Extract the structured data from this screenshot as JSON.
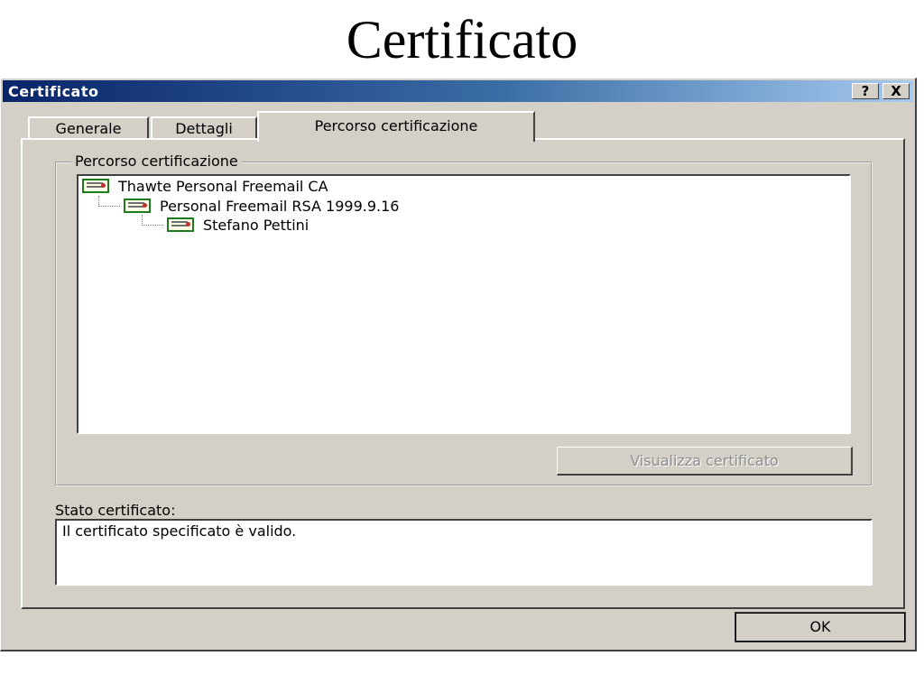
{
  "slide": {
    "title": "Certificato"
  },
  "window": {
    "title": "Certificato",
    "help_label": "?",
    "close_label": "X"
  },
  "tabs": [
    {
      "label": "Generale",
      "active": false
    },
    {
      "label": "Dettagli",
      "active": false
    },
    {
      "label": "Percorso certificazione",
      "active": true
    }
  ],
  "certification_path": {
    "group_label": "Percorso certificazione",
    "items": [
      {
        "label": "Thawte Personal Freemail CA",
        "level": 0,
        "icon": "certificate-icon"
      },
      {
        "label": "Personal Freemail RSA 1999.9.16",
        "level": 1,
        "icon": "certificate-icon"
      },
      {
        "label": "Stefano Pettini",
        "level": 2,
        "icon": "certificate-icon"
      }
    ],
    "view_button_label": "Visualizza certificato",
    "view_button_enabled": false
  },
  "status": {
    "label": "Stato certificato:",
    "text": "Il certificato specificato è valido."
  },
  "ok_label": "OK",
  "colors": {
    "titlebar_start": "#0a246a",
    "titlebar_end": "#a6caf0",
    "dialog_face": "#d4d0c8",
    "icon_border": "#1e7a1e"
  }
}
